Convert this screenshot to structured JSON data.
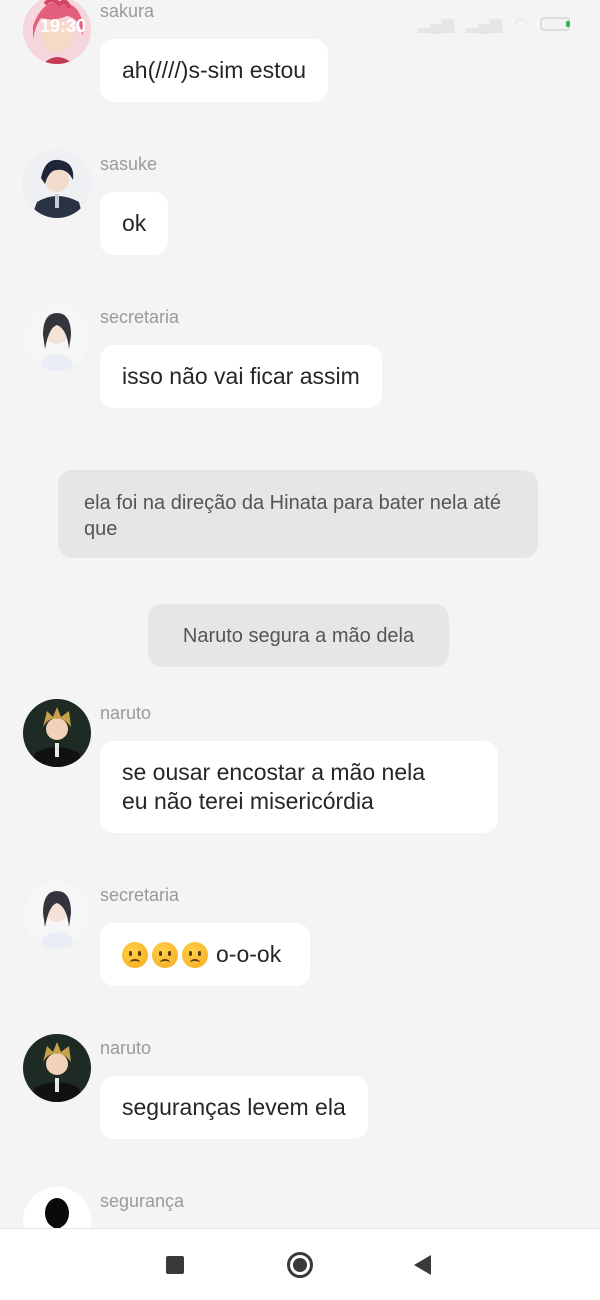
{
  "status_bar": {
    "time": "19:30",
    "signal_icon": "signal-icon",
    "wifi_icon": "wifi-icon",
    "battery_icon": "battery-icon"
  },
  "messages": [
    {
      "sender": "sakura",
      "text": "ah(////)s-sim estou",
      "avatar": "sakura-avatar"
    },
    {
      "sender": "sasuke",
      "text": "ok",
      "avatar": "sasuke-avatar"
    },
    {
      "sender": "secretaria",
      "text": "isso não vai ficar assim",
      "avatar": "secretaria-avatar"
    },
    {
      "sender": "naruto",
      "text": "se ousar encostar a mão nela\neu não terei misericórdia",
      "avatar": "naruto-avatar"
    },
    {
      "sender": "secretaria",
      "text": "o-o-ok",
      "emoji": "worried-face-emoji",
      "emoji_count": 3,
      "avatar": "secretaria-avatar"
    },
    {
      "sender": "naruto",
      "text": "seguranças levem ela",
      "avatar": "naruto-avatar"
    },
    {
      "sender": "segurança",
      "text": "",
      "avatar": "seguranca-avatar"
    }
  ],
  "narrations": [
    "ela foi na direção da Hinata para bater nela até que",
    "Naruto segura a mão dela"
  ],
  "nav_bar": {
    "recents_icon": "square-recents-icon",
    "home_icon": "circle-home-icon",
    "back_icon": "triangle-back-icon"
  },
  "colors": {
    "background": "#f4f4f4",
    "bubble": "#ffffff",
    "narration": "#e6e6e6",
    "sender_name": "#9a9a9a"
  }
}
